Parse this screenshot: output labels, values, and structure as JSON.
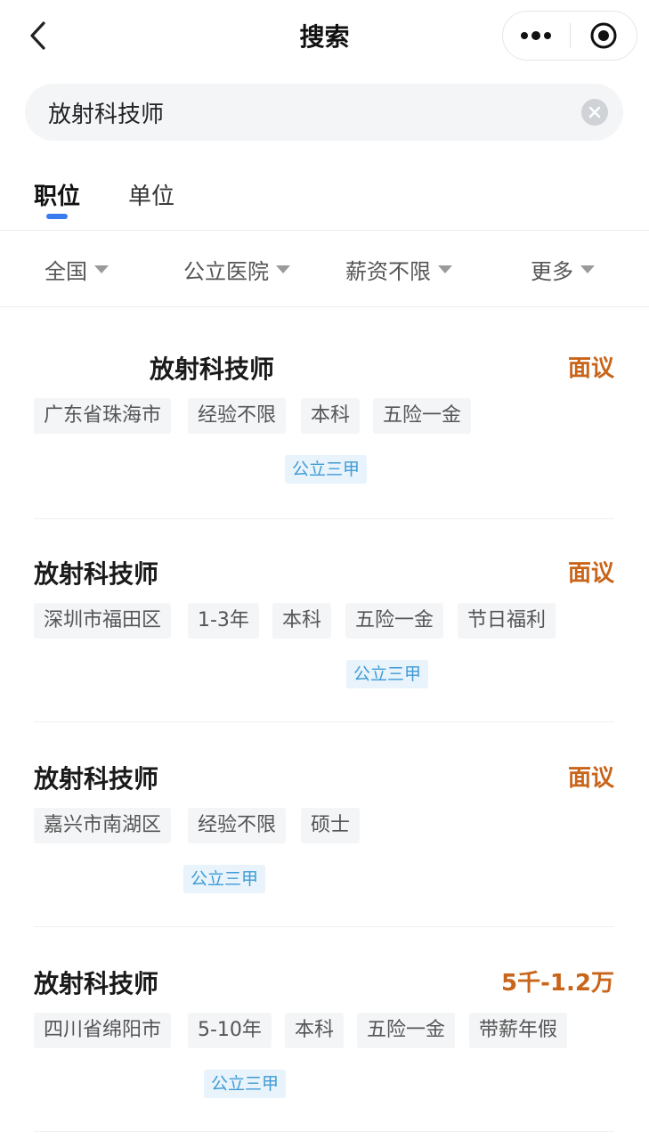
{
  "nav": {
    "title": "搜索"
  },
  "search": {
    "value": "放射科技师",
    "placeholder": ""
  },
  "tabs": [
    {
      "label": "职位",
      "active": true
    },
    {
      "label": "单位",
      "active": false
    }
  ],
  "filters": [
    {
      "label": "全国"
    },
    {
      "label": "公立医院"
    },
    {
      "label": "薪资不限"
    },
    {
      "label": "更多"
    }
  ],
  "jobs": [
    {
      "title": "放射科技师",
      "salary": "面议",
      "tags": [
        "广东省珠海市",
        "经验不限",
        "本科",
        "五险一金"
      ],
      "badge": "公立三甲"
    },
    {
      "title": "放射科技师",
      "salary": "面议",
      "tags": [
        "深圳市福田区",
        "1-3年",
        "本科",
        "五险一金",
        "节日福利"
      ],
      "badge": "公立三甲"
    },
    {
      "title": "放射科技师",
      "salary": "面议",
      "tags": [
        "嘉兴市南湖区",
        "经验不限",
        "硕士"
      ],
      "badge": "公立三甲"
    },
    {
      "title": "放射科技师",
      "salary": "5千-1.2万",
      "tags": [
        "四川省绵阳市",
        "5-10年",
        "本科",
        "五险一金",
        "带薪年假"
      ],
      "badge": "公立三甲"
    }
  ],
  "colors": {
    "accent": "#3a7cf0",
    "salary": "#c9651b",
    "badge_text": "#3e9bd6",
    "badge_bg": "#e8f3fb",
    "tag_bg": "#f4f5f7"
  }
}
